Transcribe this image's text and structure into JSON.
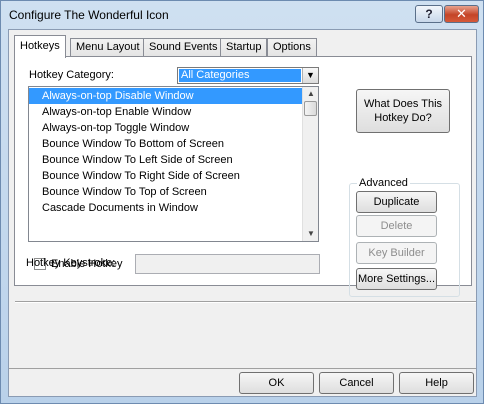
{
  "window": {
    "title": "Configure The Wonderful Icon",
    "help_glyph": "?",
    "close_glyph": "✕"
  },
  "tabs": [
    {
      "label": "Hotkeys",
      "active": true
    },
    {
      "label": "Menu Layout"
    },
    {
      "label": "Sound Events"
    },
    {
      "label": "Startup"
    },
    {
      "label": "Options"
    }
  ],
  "hotkeys": {
    "category_label": "Hotkey Category:",
    "category_value": "All Categories",
    "list_items": [
      "Always-on-top Disable Window",
      "Always-on-top Enable Window",
      "Always-on-top Toggle Window",
      "Bounce Window To Bottom of Screen",
      "Bounce Window To Left Side of Screen",
      "Bounce Window To Right Side of Screen",
      "Bounce Window To Top of Screen",
      "Cascade Documents in Window"
    ],
    "selected_index": 0,
    "what_does_button": "What Does This Hotkey Do?",
    "advanced_caption": "Advanced",
    "duplicate_button": "Duplicate",
    "delete_button": "Delete",
    "key_builder_button": "Key Builder",
    "more_settings_button": "More Settings...",
    "enable_label": "Enable Hotkey",
    "enable_checked": false,
    "keystroke_label": "Hotkey Keystroke:",
    "keystroke_value": ""
  },
  "footer": {
    "ok_button": "OK",
    "cancel_button": "Cancel",
    "help_button": "Help"
  }
}
